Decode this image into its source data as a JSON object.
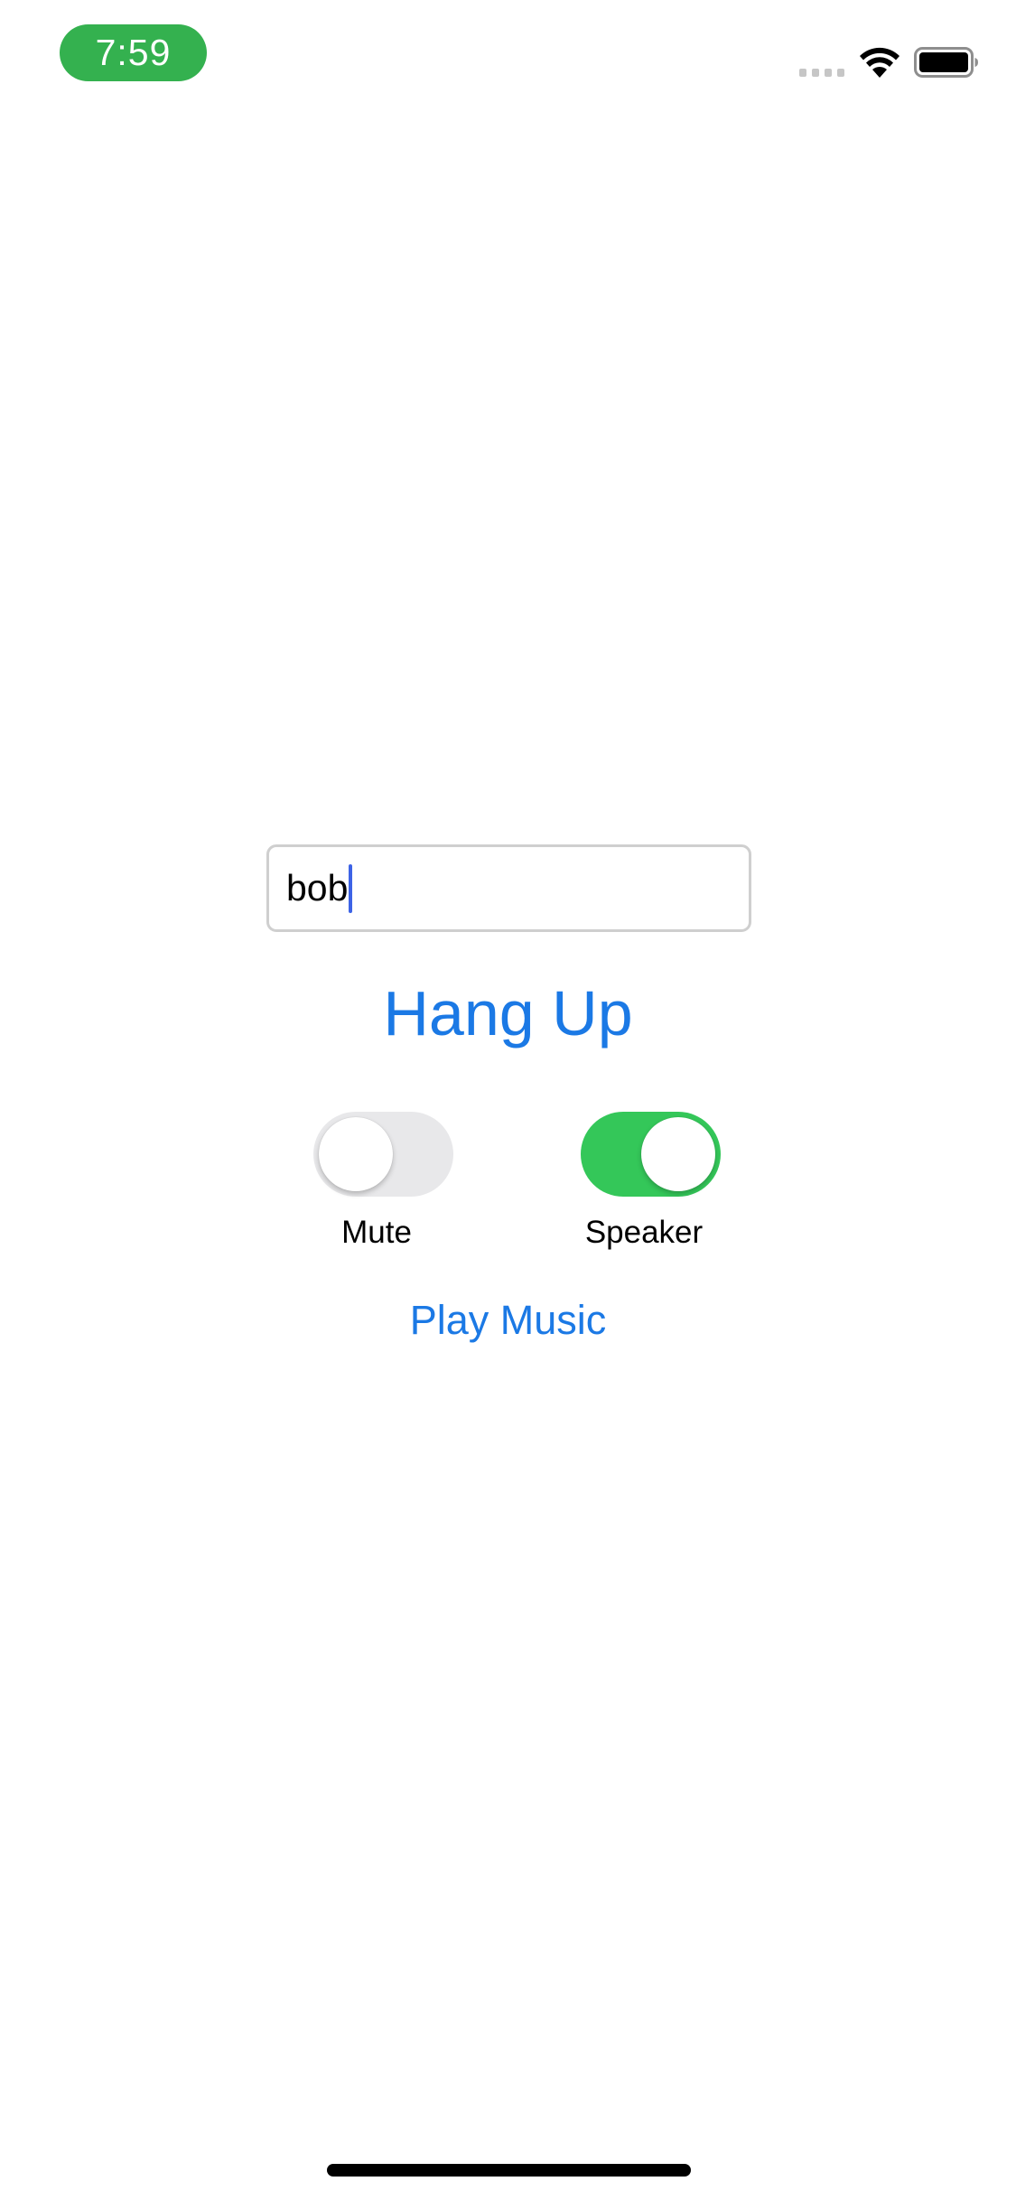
{
  "status_bar": {
    "time": "7:59",
    "time_pill_color": "#34b14f",
    "icons": [
      "cellular-signal-icon",
      "wifi-icon",
      "battery-icon"
    ]
  },
  "call_form": {
    "name_field": {
      "value": "bob",
      "focused": true
    },
    "hang_up_label": "Hang Up",
    "toggles": {
      "mute": {
        "label": "Mute",
        "on": false
      },
      "speaker": {
        "label": "Speaker",
        "on": true
      }
    },
    "play_music_label": "Play Music"
  },
  "colors": {
    "accent": "#1b79e5",
    "toggle_on": "#34c759",
    "toggle_off": "#e8e8ea",
    "cursor": "#3d63e6"
  }
}
